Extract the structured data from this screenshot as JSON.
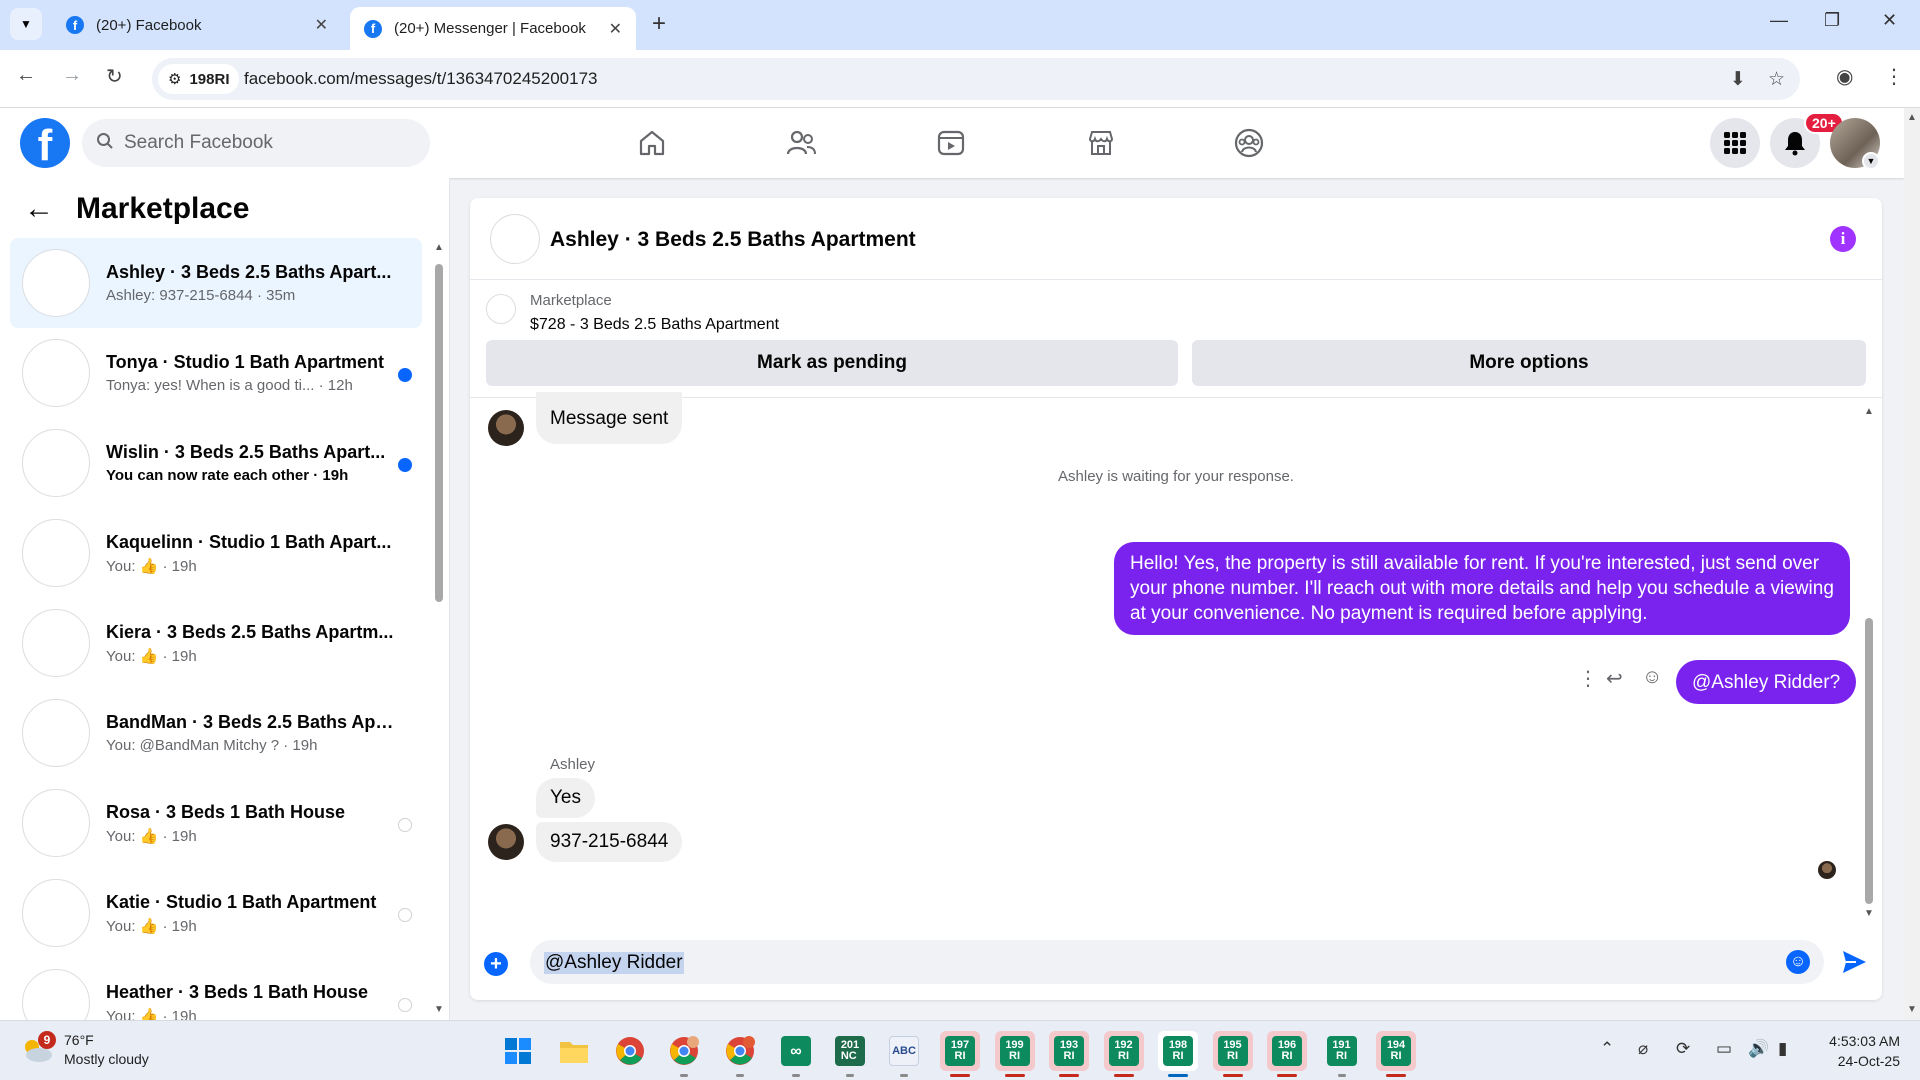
{
  "browser": {
    "tabs": [
      {
        "label": "(20+) Facebook",
        "active": false
      },
      {
        "label": "(20+) Messenger | Facebook",
        "active": true
      }
    ],
    "site_chip": "198RI",
    "url": "facebook.com/messages/t/1363470245200173"
  },
  "fb": {
    "logo_letter": "f",
    "search_placeholder": "Search Facebook",
    "notification_count": "20+"
  },
  "sidebar": {
    "heading": "Marketplace",
    "conversations": [
      {
        "title": "Ashley · 3 Beds 2.5 Baths Apart...",
        "preview": "Ashley: 937-215-6844 · 35m",
        "selected": true,
        "unread": false,
        "status": "none"
      },
      {
        "title": "Tonya · Studio 1 Bath Apartment",
        "preview": "Tonya: yes! When is a good ti... · 12h",
        "selected": false,
        "unread": false,
        "status": "blue"
      },
      {
        "title": "Wislin · 3 Beds 2.5 Baths Apart...",
        "preview": "You can now rate each other · 19h",
        "selected": false,
        "unread": true,
        "status": "blue"
      },
      {
        "title": "Kaquelinn · Studio 1 Bath Apart...",
        "preview": "You: 👍 · 19h",
        "selected": false,
        "unread": false,
        "status": "none"
      },
      {
        "title": "Kiera · 3 Beds 2.5 Baths Apartm...",
        "preview": "You: 👍 · 19h",
        "selected": false,
        "unread": false,
        "status": "none"
      },
      {
        "title": "BandMan · 3 Beds 2.5 Baths Apa...",
        "preview": "You: @BandMan Mitchy ? · 19h",
        "selected": false,
        "unread": false,
        "status": "none"
      },
      {
        "title": "Rosa · 3 Beds 1 Bath House",
        "preview": "You: 👍 · 19h",
        "selected": false,
        "unread": false,
        "status": "ring"
      },
      {
        "title": "Katie · Studio 1 Bath Apartment",
        "preview": "You: 👍 · 19h",
        "selected": false,
        "unread": false,
        "status": "ring"
      },
      {
        "title": "Heather · 3 Beds 1 Bath House",
        "preview": "You: 👍 · 19h",
        "selected": false,
        "unread": false,
        "status": "ring"
      }
    ]
  },
  "chat": {
    "title": "Ashley · 3 Beds 2.5 Baths Apartment",
    "listing_category": "Marketplace",
    "listing_title": "$728 - 3 Beds 2.5 Baths Apartment",
    "mark_pending_label": "Mark as pending",
    "more_options_label": "More options",
    "messages": {
      "sent_notice": "Message sent",
      "waiting_notice": "Ashley is waiting for your response.",
      "outgoing_long": "Hello! Yes, the property is still available for rent. If you're interested, just send over your phone number. I'll reach out with more details and help you schedule a viewing at your convenience. No payment is required before applying.",
      "outgoing_mention": "@Ashley Ridder?",
      "incoming_sender": "Ashley",
      "incoming_1": "Yes",
      "incoming_2": "937-215-6844"
    },
    "composer_value": "@Ashley Ridder"
  },
  "taskbar": {
    "weather_badge": "9",
    "temperature": "76°F",
    "condition": "Mostly cloudy",
    "pinned_sites": [
      {
        "top": "197",
        "bottom": "RI",
        "highlight": true
      },
      {
        "top": "199",
        "bottom": "RI",
        "highlight": true
      },
      {
        "top": "193",
        "bottom": "RI",
        "highlight": true
      },
      {
        "top": "192",
        "bottom": "RI",
        "highlight": true
      },
      {
        "top": "198",
        "bottom": "RI",
        "highlight": false,
        "current": true
      },
      {
        "top": "195",
        "bottom": "RI",
        "highlight": true
      },
      {
        "top": "196",
        "bottom": "RI",
        "highlight": true
      },
      {
        "top": "191",
        "bottom": "RI",
        "highlight": false
      },
      {
        "top": "194",
        "bottom": "RI",
        "highlight": true
      }
    ],
    "time": "4:53:03 AM",
    "date": "24-Oct-25"
  },
  "colors": {
    "fb_blue": "#1877f2",
    "messenger_purple": "#7a22ee",
    "unread_blue": "#0866ff",
    "notif_red": "#e41e3f"
  }
}
